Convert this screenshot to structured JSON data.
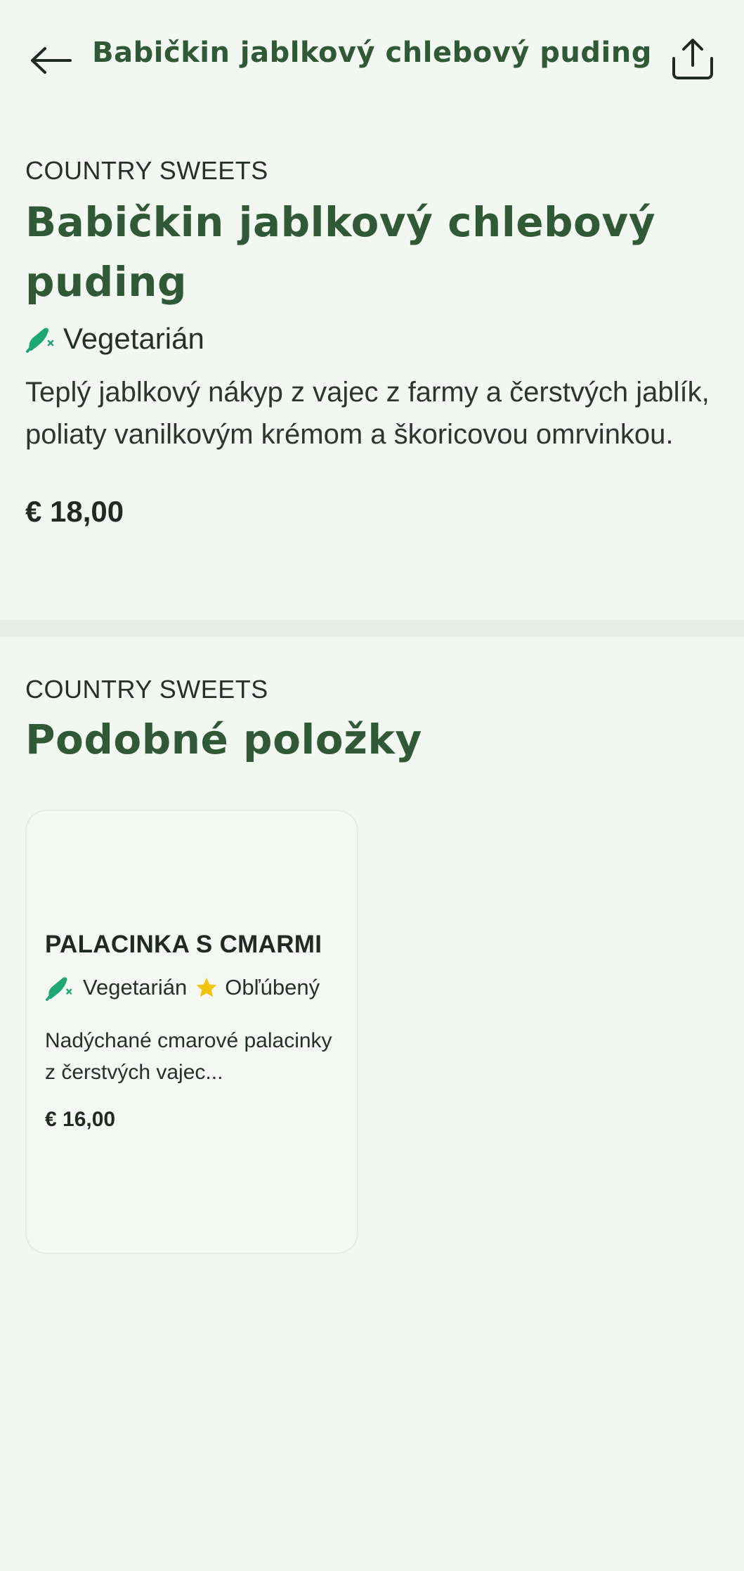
{
  "header": {
    "title": "Babičkin jablkový chlebový puding",
    "back_icon": "arrow-left-icon",
    "share_icon": "share-icon"
  },
  "product": {
    "category": "COUNTRY SWEETS",
    "title": "Babičkin jablkový chlebový puding",
    "tag": "Vegetarián",
    "description": "Teplý jablkový nákyp z vajec z farmy a čerstvých jablík, poliaty vanilkovým krémom a škoricovou omrvinkou.",
    "price": "€ 18,00"
  },
  "similar": {
    "category": "COUNTRY SWEETS",
    "title": "Podobné položky",
    "items": [
      {
        "title": "PALACINKA S CMARMI",
        "tags": [
          "Vegetarián",
          "Obľúbený"
        ],
        "description": "Nadýchané cmarové palacinky z čerstvých vajec...",
        "price": "€ 16,00"
      }
    ]
  },
  "colors": {
    "background": "#f3f7f2",
    "title_green": "#2f5a35",
    "vegetarian_green": "#1fa773",
    "star_yellow": "#f1c40f"
  }
}
